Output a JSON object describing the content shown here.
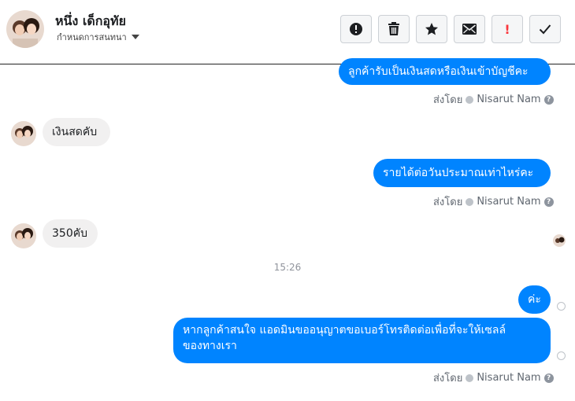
{
  "header": {
    "contact_name": "หนึ่ง เด็กอุทัย",
    "manage_label": "กำหนดการสนทนา",
    "toolbar_marks": {
      "red_alert": "!"
    }
  },
  "messages": [
    {
      "direction": "out",
      "text": "ลูกค้ารับเป็นเงินสดหรือเงินเข้าบัญชีคะ"
    },
    {
      "direction": "in",
      "text": "เงินสดคับ"
    },
    {
      "direction": "out",
      "text": "รายได้ต่อวันประมาณเท่าไหร่คะ"
    },
    {
      "direction": "in",
      "text": "350คับ"
    },
    {
      "direction": "out",
      "text": "ค่ะ"
    },
    {
      "direction": "out",
      "lines": [
        "หากลูกค้าสนใจ แอดมินขออนุญาตขอเบอร์โทรติดต่อเพื่อที่จะให้เซลล์",
        "ของทางเรา"
      ]
    }
  ],
  "sent_by": {
    "prefix": "ส่งโดย",
    "name": "Nisarut Nam",
    "help": "?"
  },
  "timestamp": "15:26",
  "colors": {
    "outgoing": "#0084ff",
    "incoming": "#f1f0f0",
    "alert_red": "#fa383e"
  },
  "icons": [
    "alert-icon",
    "trash-icon",
    "star-icon",
    "mail-icon",
    "important-icon",
    "check-icon"
  ]
}
